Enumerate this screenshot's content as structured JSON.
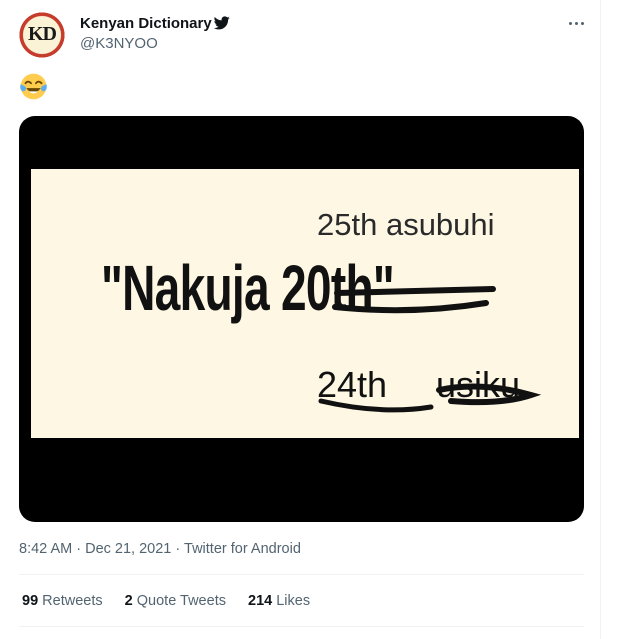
{
  "tweet": {
    "author": {
      "display_name": "Kenyan Dictionary",
      "handle": "@K3NYOO",
      "avatar_initials": "KD",
      "verified_icon": "twitter-bird-icon"
    },
    "more_icon": "more-horizontal-icon",
    "text_emoji": "face-with-tears-of-joy",
    "image": {
      "time_label": "25th asubuhi",
      "main_text": "\"Nakuja",
      "struck_date": "20th\"",
      "handwritten_date": "24th",
      "handwritten_word": "usiku"
    },
    "meta": {
      "time": "8:42 AM",
      "separator": "·",
      "date": "Dec 21, 2021",
      "source": "Twitter for Android"
    },
    "stats": {
      "retweets_count": "99",
      "retweets_label": "Retweets",
      "quotes_count": "2",
      "quotes_label": "Quote Tweets",
      "likes_count": "214",
      "likes_label": "Likes"
    },
    "colors": {
      "secondary_text": "#536471",
      "primary_text": "#0f1419",
      "divider": "#eff3f4"
    }
  }
}
